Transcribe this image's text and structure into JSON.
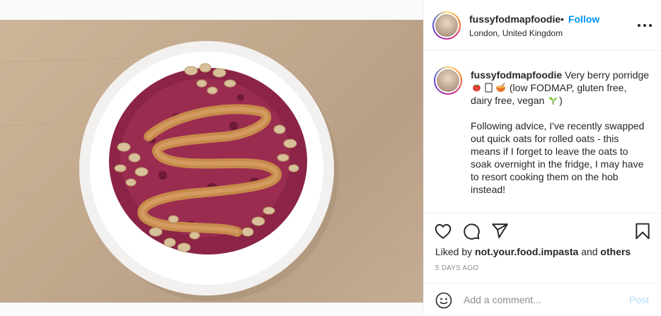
{
  "post": {
    "username": "fussyfodmapfoodie",
    "separator": "•",
    "follow_label": "Follow",
    "location": "London, United Kingdom",
    "more_icon": "more-horizontal-icon"
  },
  "caption": {
    "username": "fussyfodmapfoodie",
    "line1_text": " Very berry porridge ",
    "line1_suffix": " (low FODMAP, gluten free, dairy free, vegan ",
    "line1_end": ")",
    "paragraph2": "Following advice, I've recently swapped out quick oats for rolled oats - this means if I forget to leave the oats to soak overnight in the fridge, I may have to resort cooking them on the hob instead!",
    "emoji_icons": [
      "strawberry-emoji",
      "unknown-glyph",
      "bowl-emoji",
      "seedling-emoji"
    ]
  },
  "actions": {
    "icons": [
      "heart-icon",
      "comment-icon",
      "share-icon",
      "bookmark-icon"
    ],
    "liked_by_prefix": "Liked by ",
    "liked_by_user": "not.your.food.impasta",
    "liked_by_and": " and ",
    "liked_by_others": "others",
    "date": "5 DAYS AGO"
  },
  "comment": {
    "placeholder": "Add a comment...",
    "post_label": "Post",
    "smile_icon": "smile-icon"
  },
  "colors": {
    "follow": "#0095f6",
    "post_disabled": "#b2dffc",
    "muted": "#8e8e8e"
  }
}
